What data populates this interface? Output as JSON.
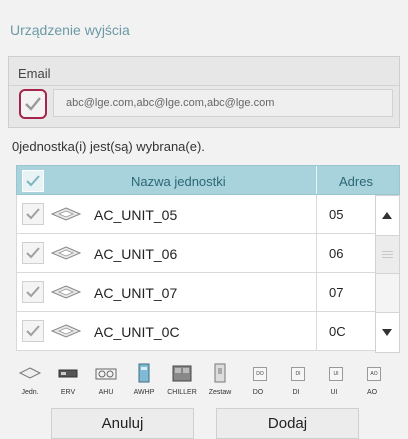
{
  "dialog": {
    "title": "Urządzenie wyjścia"
  },
  "email": {
    "label": "Email",
    "value": "abc@lge.com,abc@lge.com,abc@lge.com",
    "checkbox_checked": true,
    "highlight_color": "#a5254c"
  },
  "selection_count": "0jednostka(i) jest(są) wybrana(e).",
  "table": {
    "header_check": true,
    "col_name": "Nazwa jednostki",
    "col_address": "Adres",
    "header_color": "#a8d3dc",
    "rows": [
      {
        "name": "AC_UNIT_05",
        "address": "05",
        "icon": "cassette-ac-icon",
        "checked": true
      },
      {
        "name": "AC_UNIT_06",
        "address": "06",
        "icon": "cassette-ac-icon",
        "checked": true
      },
      {
        "name": "AC_UNIT_07",
        "address": "07",
        "icon": "cassette-ac-icon",
        "checked": true
      },
      {
        "name": "AC_UNIT_0C",
        "address": "0C",
        "icon": "cassette-ac-icon",
        "checked": true
      }
    ]
  },
  "filters": [
    {
      "label": "Jedn.",
      "icon": "cassette-ac-icon"
    },
    {
      "label": "ERV",
      "icon": "erv-icon"
    },
    {
      "label": "AHU",
      "icon": "ahu-icon"
    },
    {
      "label": "AWHP",
      "icon": "awhp-icon"
    },
    {
      "label": "CHILLER",
      "icon": "chiller-icon"
    },
    {
      "label": "Zestaw",
      "icon": "zestaw-icon"
    },
    {
      "label": "DO",
      "icon": "do-icon",
      "badge": "DO"
    },
    {
      "label": "DI",
      "icon": "di-icon",
      "badge": "DI"
    },
    {
      "label": "UI",
      "icon": "ui-icon",
      "badge": "UI"
    },
    {
      "label": "AO",
      "icon": "ao-icon",
      "badge": "AO"
    }
  ],
  "buttons": {
    "cancel": "Anuluj",
    "add": "Dodaj"
  }
}
